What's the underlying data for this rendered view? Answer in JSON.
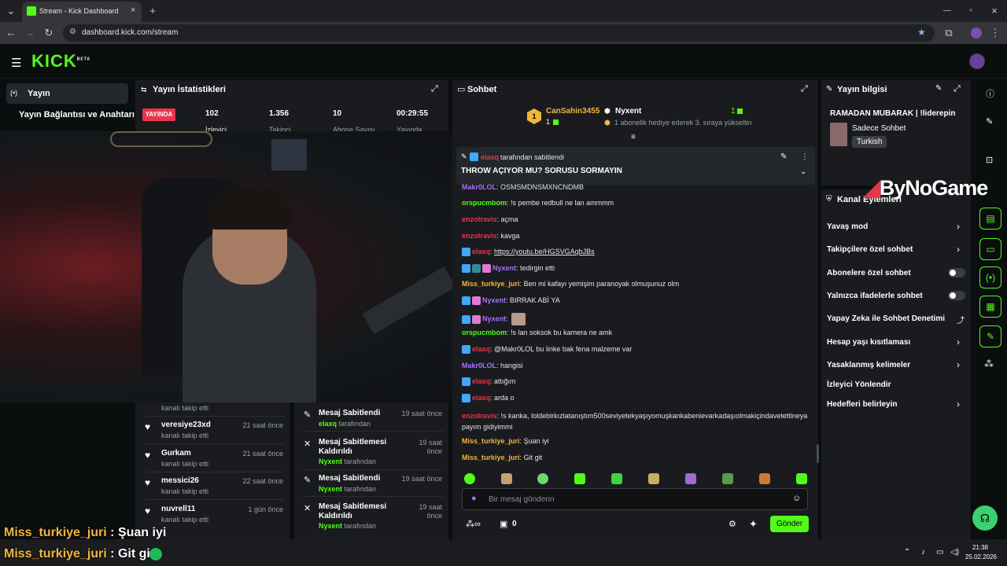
{
  "browser": {
    "tab_title": "Stream - Kick Dashboard",
    "url": "dashboard.kick.com/stream"
  },
  "header": {
    "logo": "KICK",
    "logo_sup": "BETA"
  },
  "sidebar": {
    "items": [
      {
        "label": "Yayın"
      },
      {
        "label": "Yayın Bağlantısı ve Anahtarı"
      }
    ]
  },
  "stats": {
    "title": "Yayın İstatistikleri",
    "live_badge": "YAYINDA",
    "values": [
      {
        "value": "102",
        "label": "İzleyici"
      },
      {
        "value": "1.356",
        "label": "Takipçi"
      },
      {
        "value": "10",
        "label": "Abone Sayısı"
      },
      {
        "value": "00:29:55",
        "label": "Yayında"
      }
    ]
  },
  "activity": {
    "items": [
      {
        "name": "",
        "sub": "kanalı takip etti",
        "time": ""
      },
      {
        "name": "veresiye23xd",
        "sub": "kanalı takip etti",
        "time": "21 saat önce"
      },
      {
        "name": "Gurkam",
        "sub": "kanalı takip etti",
        "time": "21 saat önce"
      },
      {
        "name": "messici26",
        "sub": "kanalı takip etti",
        "time": "22 saat önce"
      },
      {
        "name": "nuvrell11",
        "sub": "kanalı takip etti",
        "time": "1 gün önce"
      }
    ]
  },
  "mod_log": {
    "items": [
      {
        "title": "Mesaj Sabitlendi",
        "user": "elaxq",
        "suffix": "tarafından",
        "time": "19 saat önce"
      },
      {
        "title": "Mesaj Sabitlemesi Kaldırıldı",
        "user": "Nyxent",
        "suffix": "tarafından",
        "time": "19 saat önce"
      },
      {
        "title": "Mesaj Sabitlendi",
        "user": "Nyxent",
        "suffix": "tarafından",
        "time": "19 saat önce"
      },
      {
        "title": "Mesaj Sabitlemesi Kaldırıldı",
        "user": "Nyxent",
        "suffix": "tarafından",
        "time": "19 saat önce"
      }
    ]
  },
  "chat": {
    "title": "Sohbet",
    "leader1_name": "CanSahin3455",
    "leader1_count": "1",
    "leader1_rank": "1",
    "leader2_name": "Nyxent",
    "leader2_count": "1",
    "leader2_note": "1 abonelik hediye ederek 3. sıraya yükseltin",
    "pinned_by": "elaxq",
    "pinned_by_suffix": "tarafından sabitlendi",
    "pinned_text": "THROW AÇIYOR MU? SORUSU SORMAYIN",
    "messages": [
      {
        "user": "Makr0LOL",
        "text": "OSMSMDNSMXNCNDMB",
        "color": "#a970ff"
      },
      {
        "user": "orspucmbom",
        "text": "!s pembe redbull ne lan ammmm",
        "color": "#53fc18"
      },
      {
        "user": "enzotravis",
        "text": "açma",
        "color": "#e8354a"
      },
      {
        "user": "enzotravis",
        "text": "kavga",
        "color": "#e8354a"
      },
      {
        "user": "elaxq",
        "text": "https://youtu.be/HGSVGAqbJBs",
        "color": "#e8354a"
      },
      {
        "user": "Nyxent",
        "text": "tedirgin etti",
        "color": "#a970ff"
      },
      {
        "user": "Miss_turkiye_juri",
        "text": "Ben mi kafayı yemişim paranoyak olmuşunuz olm",
        "color": "#f2b63b"
      },
      {
        "user": "Nyxent",
        "text": "BIRRAK ABİ YA",
        "color": "#a970ff"
      },
      {
        "user": "Nyxent",
        "text": "",
        "color": "#a970ff"
      },
      {
        "user": "orspucmbom",
        "text": "!s lan soksok bu kamera ne amk",
        "color": "#53fc18"
      },
      {
        "user": "elaxq",
        "text": "@Makr0LOL bu linke bak fena malzeme var",
        "color": "#e8354a"
      },
      {
        "user": "Makr0LOL",
        "text": "hangisi",
        "color": "#a970ff"
      },
      {
        "user": "elaxq",
        "text": "attığım",
        "color": "#e8354a"
      },
      {
        "user": "elaxq",
        "text": "arda o",
        "color": "#e8354a"
      },
      {
        "user": "enzotravis",
        "text": "!s kanka, loldebirkızlatanıştım500seviyetekyaşıyomuşkankabenievarkadaşıolmakiçindavetettineyapayım gidiyimmi",
        "color": "#e8354a"
      },
      {
        "user": "Miss_turkiye_juri",
        "text": "Şuan iyi",
        "color": "#f2b63b"
      },
      {
        "user": "Miss_turkiye_juri",
        "text": "Git git",
        "color": "#f2b63b"
      }
    ],
    "input_placeholder": "Bir mesaj gönderin",
    "points": "0",
    "send_label": "Gönder"
  },
  "stream_info": {
    "title": "Yayın bilgisi",
    "stream_title": "RAMADAN MUBARAK | !liderepin",
    "category": "Sadece Sohbet",
    "language": "Turkish"
  },
  "channel_actions": {
    "title": "Kanal Eylemleri",
    "items": [
      {
        "label": "Yavaş mod",
        "control": "chevron"
      },
      {
        "label": "Takipçilere özel sohbet",
        "control": "chevron"
      },
      {
        "label": "Abonelere özel sohbet",
        "control": "toggle"
      },
      {
        "label": "Yalnızca ifadelerle sohbet",
        "control": "toggle"
      },
      {
        "label": "Yapay Zeka ile Sohbet Denetimi",
        "control": "external"
      },
      {
        "label": "Hesap yaşı kısıtlaması",
        "control": "chevron"
      },
      {
        "label": "Yasaklanmış kelimeler",
        "control": "chevron"
      },
      {
        "label": "İzleyici Yönlendir",
        "control": "none"
      },
      {
        "label": "Hedefleri belirleyin",
        "control": "chevron"
      }
    ]
  },
  "overlay": {
    "watermark": "ByNoGame",
    "overlay_line1_user": "Miss_turkiye_juri",
    "overlay_line1_text": "Şuan iyi",
    "overlay_line2_user": "Miss_turkiye_juri",
    "overlay_line2_text": "Git git"
  },
  "taskbar": {
    "time": "21:38",
    "date": "25.02.2026"
  },
  "colors": {
    "accent": "#53fc18",
    "panel": "#191b1f",
    "bg": "#0b0e0f",
    "live": "#e8354a"
  }
}
